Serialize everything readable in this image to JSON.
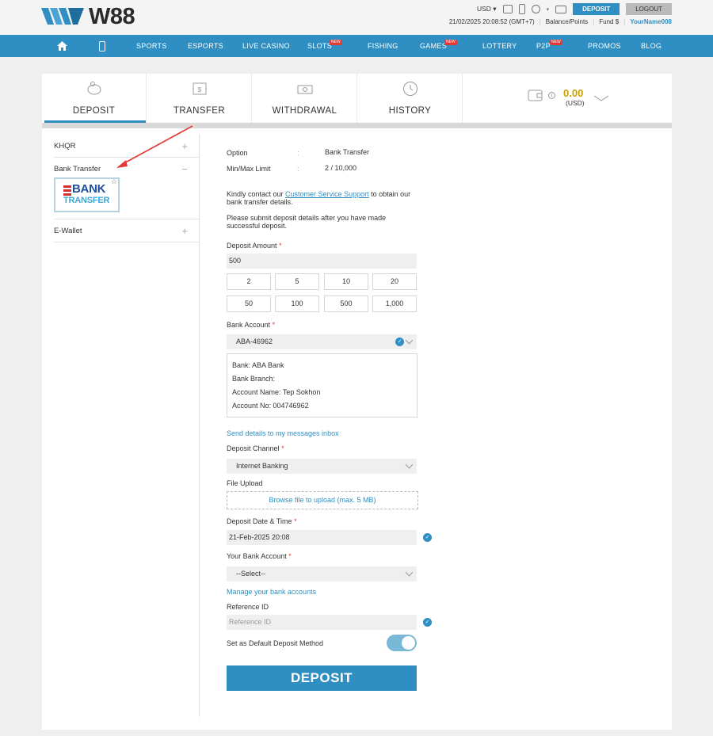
{
  "brand": {
    "logo_text": "W88",
    "logo_mark_color": "#2f8fc3"
  },
  "topbar": {
    "currency": "USD",
    "datetime": "21/02/2025 20:08:52 (GMT+7)",
    "balance_label": "Balance/Points",
    "fund_label": "Fund $",
    "username": "YourName008",
    "deposit_label": "DEPOSIT",
    "logout_label": "LOGOUT"
  },
  "nav": {
    "items": [
      "SPORTS",
      "ESPORTS",
      "LIVE CASINO",
      "SLOTS",
      "FISHING",
      "GAMES",
      "LOTTERY",
      "P2P",
      "PROMOS",
      "BLOG"
    ],
    "new_badge": "NEW"
  },
  "tabs": [
    {
      "label": "DEPOSIT"
    },
    {
      "label": "TRANSFER"
    },
    {
      "label": "WITHDRAWAL"
    },
    {
      "label": "HISTORY"
    }
  ],
  "wallet": {
    "amount": "0.00",
    "currency": "(USD)"
  },
  "sidebar": {
    "items": [
      {
        "label": "KHQR",
        "toggle": "+"
      },
      {
        "label": "Bank Transfer",
        "toggle": "−"
      },
      {
        "label": "E-Wallet",
        "toggle": "+"
      }
    ],
    "bank_logo_line1": "BANK",
    "bank_logo_line2": "TRANSFER"
  },
  "form": {
    "option_label": "Option",
    "option_value": "Bank Transfer",
    "limit_label": "Min/Max Limit",
    "limit_value": "2 / 10,000",
    "sep": ":",
    "contact_pre": "Kindly contact our ",
    "contact_link": "Customer Service Support",
    "contact_post": " to obtain our bank transfer details.",
    "submit_note": "Please submit deposit details after you have made successful deposit.",
    "amount_label": "Deposit Amount",
    "amount_value": "500",
    "chips": [
      "2",
      "5",
      "10",
      "20",
      "50",
      "100",
      "500",
      "1,000"
    ],
    "bank_account_label": "Bank Account",
    "bank_account_value": "ABA-46962",
    "bank_details": [
      "Bank: ABA Bank",
      "Bank Branch:",
      "Account Name: Tep Sokhon",
      "Account No: 004746962"
    ],
    "send_details": "Send details to my messages inbox",
    "channel_label": "Deposit Channel",
    "channel_value": "Internet Banking",
    "upload_label": "File Upload",
    "upload_text": "Browse file to upload (max. 5 MB)",
    "date_label": "Deposit Date & Time",
    "date_value": "21-Feb-2025 20:08",
    "your_bank_label": "Your Bank Account",
    "your_bank_value": "--Select--",
    "manage_link": "Manage your bank accounts",
    "ref_label": "Reference ID",
    "ref_placeholder": "Reference ID",
    "default_label": "Set as Default Deposit Method",
    "required_mark": "*",
    "submit_label": "DEPOSIT"
  }
}
